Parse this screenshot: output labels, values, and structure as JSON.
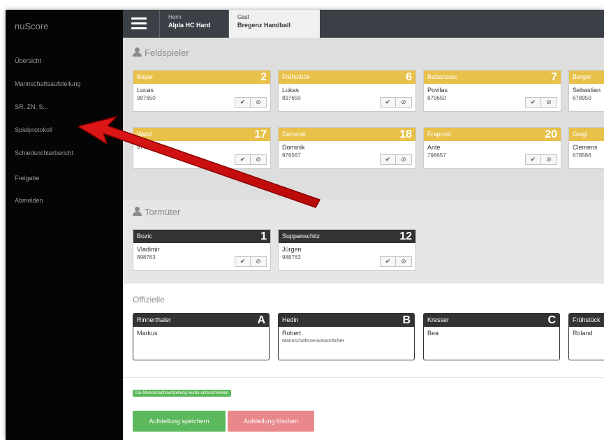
{
  "app_title": "nuScore",
  "nav": [
    "Übersicht",
    "Mannschaftsaufstellung",
    "SR, ZN, S...",
    "Spielprotokoll",
    "Schiedsrichterbericht",
    "Freigabe",
    "Abmelden"
  ],
  "tabs": {
    "home": {
      "label": "Heim",
      "name": "Alpla HC Hard"
    },
    "guest": {
      "label": "Gast",
      "name": "Bregenz Handball"
    }
  },
  "field_players": {
    "title": "Feldspieler",
    "players": [
      {
        "last": "Bayer",
        "number": "2",
        "first": "Lucas",
        "id": "987650"
      },
      {
        "last": "Frühstück",
        "number": "6",
        "first": "Lukas",
        "id": "897650"
      },
      {
        "last": "Babarskas",
        "number": "7",
        "first": "Povilas",
        "id": "879650"
      },
      {
        "last": "Berger",
        "number": "",
        "first": "Sebastian",
        "id": "678950"
      },
      {
        "last": "Watzl",
        "number": "17",
        "first": "",
        "id": "976658"
      },
      {
        "last": "Demmer",
        "number": "18",
        "first": "Dominik",
        "id": "976567"
      },
      {
        "last": "Frapović",
        "number": "20",
        "first": "Ante",
        "id": "798657"
      },
      {
        "last": "Geigl",
        "number": "",
        "first": "Clemens",
        "id": "678566"
      }
    ]
  },
  "goalkeepers": {
    "title": "Tormüter",
    "players": [
      {
        "last": "Bozic",
        "number": "1",
        "first": "Vladimir",
        "id": "898763"
      },
      {
        "last": "Suppanschitz",
        "number": "12",
        "first": "Jürgen",
        "id": "988763"
      }
    ]
  },
  "officials": {
    "title": "Offizielle",
    "items": [
      {
        "last": "Rinnerthaler",
        "letter": "A",
        "first": "Markus",
        "role": ""
      },
      {
        "last": "Hedin",
        "letter": "B",
        "first": "Robert",
        "role": "Mannschaftsverantwortlicher"
      },
      {
        "last": "Kresser",
        "letter": "C",
        "first": "Bea",
        "role": ""
      },
      {
        "last": "Frühstück",
        "letter": "",
        "first": "Roland",
        "role": ""
      }
    ]
  },
  "notice": "Die Mannschaftsaufstellung wurde unterschrieben",
  "buttons": {
    "save": "Aufstellung speichern",
    "delete": "Aufstellung löschen"
  },
  "icons": {
    "confirm": "✔",
    "cancel": "⊘"
  },
  "colors": {
    "sidebar": "#050505",
    "topbar": "#3b4047",
    "player_header": "#e8c14a",
    "dark_header": "#333333",
    "save": "#5cb85c",
    "delete": "#e8888a",
    "arrow": "#d40c0c"
  }
}
